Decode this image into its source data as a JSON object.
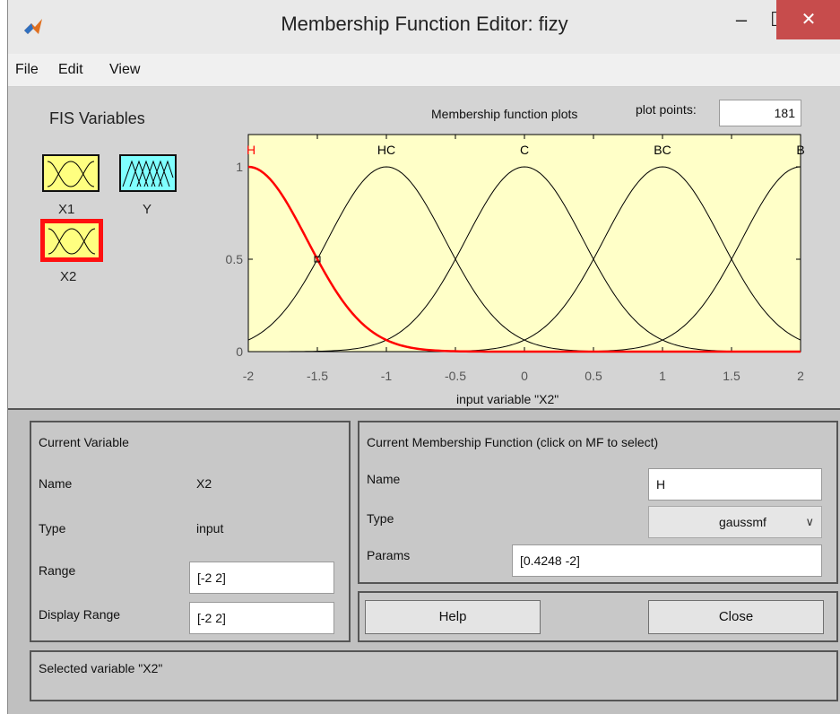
{
  "window": {
    "title": "Membership Function Editor: fizy",
    "controls": {
      "minimize": "–",
      "maximize": "☐",
      "close": "✕"
    }
  },
  "menu": [
    "File",
    "Edit",
    "View"
  ],
  "fis_variables": {
    "label": "FIS Variables",
    "items": [
      {
        "name": "X1",
        "kind": "input",
        "color": "#ffff80",
        "selected": false
      },
      {
        "name": "Y",
        "kind": "output",
        "color": "#80ffff",
        "selected": false
      },
      {
        "name": "X2",
        "kind": "input",
        "color": "#ffff80",
        "selected": true
      }
    ]
  },
  "plot": {
    "title": "Membership function plots",
    "plot_points_label": "plot points:",
    "plot_points_value": "181",
    "xlabel": "input variable \"X2\"",
    "xlim": [
      -2,
      2
    ],
    "ylim": [
      0,
      1
    ],
    "x_ticks": [
      "-2",
      "-1.5",
      "-1",
      "-0.5",
      "0",
      "0.5",
      "1",
      "1.5",
      "2"
    ],
    "y_ticks": [
      "0",
      "0.5",
      "1"
    ],
    "background": "#ffffc8",
    "membership_functions": [
      {
        "name": "H",
        "type": "gaussmf",
        "sigma": 0.4248,
        "center": -2,
        "selected": true,
        "color": "#ff0000"
      },
      {
        "name": "HC",
        "type": "gaussmf",
        "sigma": 0.4248,
        "center": -1,
        "selected": false,
        "color": "#000000"
      },
      {
        "name": "C",
        "type": "gaussmf",
        "sigma": 0.4248,
        "center": 0,
        "selected": false,
        "color": "#000000"
      },
      {
        "name": "BC",
        "type": "gaussmf",
        "sigma": 0.4248,
        "center": 1,
        "selected": false,
        "color": "#000000"
      },
      {
        "name": "B",
        "type": "gaussmf",
        "sigma": 0.4248,
        "center": 2,
        "selected": false,
        "color": "#000000"
      }
    ],
    "marker_point": {
      "x": -1.5,
      "y": 0.5
    }
  },
  "current_variable": {
    "header": "Current Variable",
    "name_label": "Name",
    "name_value": "X2",
    "type_label": "Type",
    "type_value": "input",
    "range_label": "Range",
    "range_value": "[-2 2]",
    "display_range_label": "Display Range",
    "display_range_value": "[-2 2]"
  },
  "current_mf": {
    "header": "Current Membership Function (click on MF to select)",
    "name_label": "Name",
    "name_value": "H",
    "type_label": "Type",
    "type_value": "gaussmf",
    "params_label": "Params",
    "params_value": "[0.4248 -2]"
  },
  "buttons": {
    "help": "Help",
    "close": "Close"
  },
  "status": "Selected variable \"X2\""
}
